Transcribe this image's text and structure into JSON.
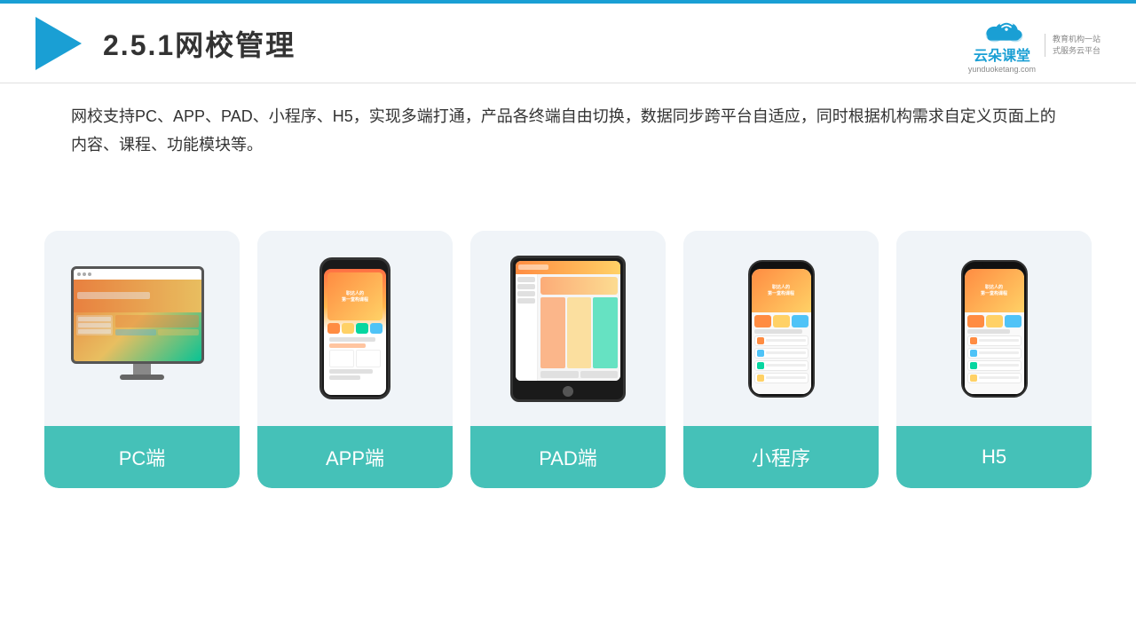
{
  "topLine": {
    "color": "#1a9fd4"
  },
  "header": {
    "prefix": "2.5.1",
    "title": "网校管理",
    "full_title": "2.5.1网校管理"
  },
  "brand": {
    "name_cn": "云朵课堂",
    "name_en": "yunduoketang.com",
    "tagline_line1": "教育机构一站",
    "tagline_line2": "式服务云平台"
  },
  "description": {
    "text": "网校支持PC、APP、PAD、小程序、H5，实现多端打通，产品各终端自由切换，数据同步跨平台自适应，同时根据机构需求自定义页面上的内容、课程、功能模块等。"
  },
  "cards": [
    {
      "id": "pc",
      "label": "PC端",
      "device_type": "pc"
    },
    {
      "id": "app",
      "label": "APP端",
      "device_type": "phone"
    },
    {
      "id": "pad",
      "label": "PAD端",
      "device_type": "tablet"
    },
    {
      "id": "miniprogram",
      "label": "小程序",
      "device_type": "mini-phone"
    },
    {
      "id": "h5",
      "label": "H5",
      "device_type": "mini-phone"
    }
  ],
  "accent_color": "#45c1b8"
}
